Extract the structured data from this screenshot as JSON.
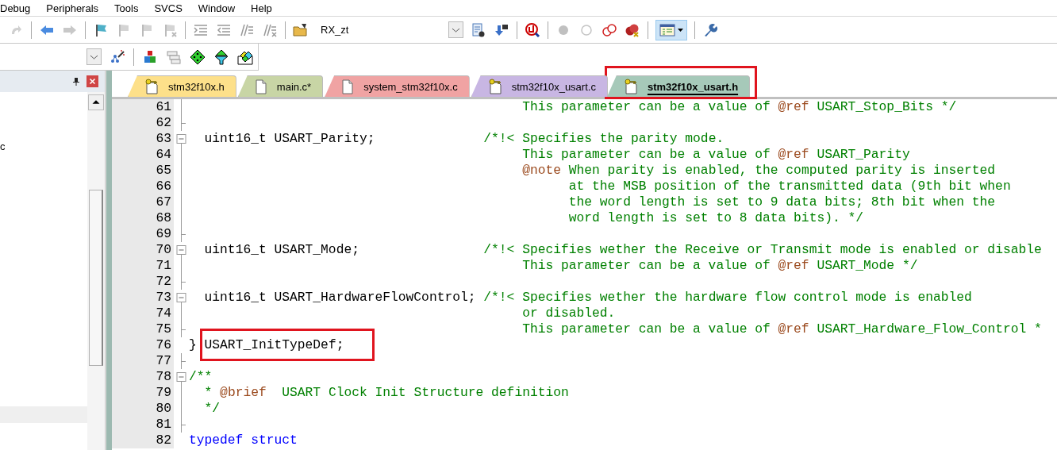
{
  "menu": [
    "Debug",
    "Peripherals",
    "Tools",
    "SVCS",
    "Window",
    "Help"
  ],
  "toolbar": {
    "target": "RX_zt",
    "window_button_pressed": true
  },
  "panel": {
    "items": [
      {
        "label": "c",
        "selected": false
      },
      {
        "selected": true
      }
    ]
  },
  "tabs": [
    {
      "label": "stm32f10x.h",
      "kind": "header",
      "color": "#fde08a",
      "selected": false,
      "highlighted": false
    },
    {
      "label": "main.c*",
      "kind": "source",
      "color": "#c8d5a5",
      "selected": false,
      "highlighted": false
    },
    {
      "label": "system_stm32f10x.c",
      "kind": "source",
      "color": "#f0a3a3",
      "selected": false,
      "highlighted": false
    },
    {
      "label": "stm32f10x_usart.c",
      "kind": "header",
      "color": "#c8b6e3",
      "selected": false,
      "highlighted": false
    },
    {
      "label": "stm32f10x_usart.h",
      "kind": "header",
      "color": "#a6c9b9",
      "selected": true,
      "highlighted": true
    }
  ],
  "lines": [
    {
      "number": "61",
      "fold": {
        "kind": "line"
      },
      "segments": [
        {
          "kind": "comment",
          "text": "                                           This parameter can be a value of "
        },
        {
          "kind": "tag",
          "text": "@ref"
        },
        {
          "kind": "comment",
          "text": " USART_Stop_Bits */"
        }
      ]
    },
    {
      "number": "62",
      "fold": {
        "kind": "end"
      }
    },
    {
      "number": "63",
      "fold": {
        "kind": "start"
      },
      "segments": [
        {
          "kind": "code",
          "text": "  uint16_t USART_Parity;              "
        },
        {
          "kind": "comment",
          "text": "/*!< Specifies the parity mode."
        }
      ]
    },
    {
      "number": "64",
      "fold": {
        "kind": "line"
      },
      "segments": [
        {
          "kind": "comment",
          "text": "                                           This parameter can be a value of "
        },
        {
          "kind": "tag",
          "text": "@ref"
        },
        {
          "kind": "comment",
          "text": " USART_Parity"
        }
      ]
    },
    {
      "number": "65",
      "fold": {
        "kind": "line"
      },
      "segments": [
        {
          "kind": "tag",
          "text": "                                           @note"
        },
        {
          "kind": "comment",
          "text": " When parity is enabled, the computed parity is inserted"
        }
      ]
    },
    {
      "number": "66",
      "fold": {
        "kind": "line"
      },
      "segments": [
        {
          "kind": "comment",
          "text": "                                                 at the MSB position of the transmitted data (9th bit when"
        }
      ]
    },
    {
      "number": "67",
      "fold": {
        "kind": "line"
      },
      "segments": [
        {
          "kind": "comment",
          "text": "                                                 the word length is set to 9 data bits; 8th bit when the"
        }
      ]
    },
    {
      "number": "68",
      "fold": {
        "kind": "line"
      },
      "segments": [
        {
          "kind": "comment",
          "text": "                                                 word length is set to 8 data bits). */"
        }
      ]
    },
    {
      "number": "69",
      "fold": {
        "kind": "end"
      }
    },
    {
      "number": "70",
      "fold": {
        "kind": "start"
      },
      "segments": [
        {
          "kind": "code",
          "text": "  uint16_t USART_Mode;                "
        },
        {
          "kind": "comment",
          "text": "/*!< Specifies wether the Receive or Transmit mode is enabled or disable"
        }
      ]
    },
    {
      "number": "71",
      "fold": {
        "kind": "line"
      },
      "segments": [
        {
          "kind": "comment",
          "text": "                                           This parameter can be a value of "
        },
        {
          "kind": "tag",
          "text": "@ref"
        },
        {
          "kind": "comment",
          "text": " USART_Mode */"
        }
      ]
    },
    {
      "number": "72",
      "fold": {
        "kind": "end"
      }
    },
    {
      "number": "73",
      "fold": {
        "kind": "start"
      },
      "segments": [
        {
          "kind": "code",
          "text": "  uint16_t USART_HardwareFlowControl; "
        },
        {
          "kind": "comment",
          "text": "/*!< Specifies wether the hardware flow control mode is enabled"
        }
      ]
    },
    {
      "number": "74",
      "fold": {
        "kind": "line"
      },
      "segments": [
        {
          "kind": "comment",
          "text": "                                           or disabled."
        }
      ]
    },
    {
      "number": "75",
      "fold": {
        "kind": "end"
      },
      "segments": [
        {
          "kind": "comment",
          "text": "                                           This parameter can be a value of "
        },
        {
          "kind": "tag",
          "text": "@ref"
        },
        {
          "kind": "comment",
          "text": " USART_Hardware_Flow_Control *"
        }
      ]
    },
    {
      "number": "76",
      "segments": [
        {
          "kind": "code",
          "text": "} ",
          "highlighted": false
        },
        {
          "kind": "code",
          "text": "USART_InitTypeDef;",
          "highlighted": true
        }
      ]
    },
    {
      "number": "77",
      "fold": {
        "kind": "end"
      }
    },
    {
      "number": "78",
      "fold": {
        "kind": "start"
      },
      "segments": [
        {
          "kind": "comment",
          "text": "/**"
        }
      ]
    },
    {
      "number": "79",
      "fold": {
        "kind": "line"
      },
      "segments": [
        {
          "kind": "comment",
          "text": "  * "
        },
        {
          "kind": "tag",
          "text": "@brief"
        },
        {
          "kind": "comment",
          "text": "  USART Clock Init Structure definition"
        }
      ]
    },
    {
      "number": "80",
      "fold": {
        "kind": "line"
      },
      "segments": [
        {
          "kind": "comment",
          "text": "  */"
        }
      ]
    },
    {
      "number": "81",
      "fold": {
        "kind": "end"
      }
    },
    {
      "number": "82",
      "segments": [
        {
          "kind": "keyword",
          "text": "typedef struct"
        }
      ]
    }
  ]
}
